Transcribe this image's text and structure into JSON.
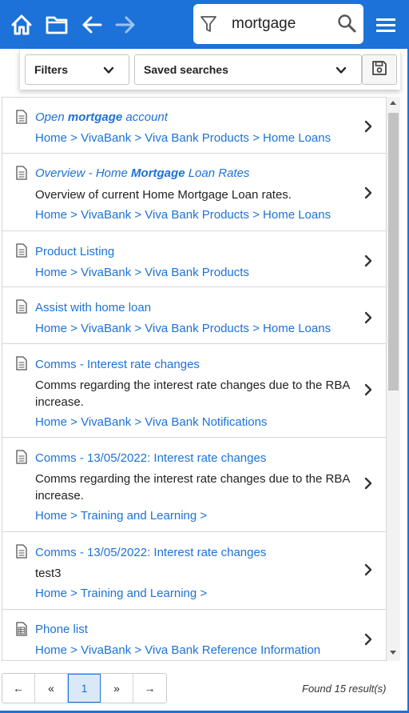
{
  "colors": {
    "accent": "#1c72d8",
    "arrow_disabled": "#9cc2f0"
  },
  "toolbar": {
    "home_icon": "home-icon",
    "folder_icon": "folder-icon",
    "back_icon": "arrow-left-icon",
    "forward_icon": "arrow-right-icon",
    "menu_icon": "hamburger-menu-icon"
  },
  "search": {
    "value": "mortgage",
    "placeholder": ""
  },
  "filters": {
    "filters_label": "Filters",
    "saved_searches_label": "Saved searches"
  },
  "results": [
    {
      "title_parts": [
        "Open ",
        "mortgage",
        " account"
      ],
      "italic": true,
      "description": "",
      "path": "Home > VivaBank > Viva Bank Products > Home Loans",
      "icon": "document-icon"
    },
    {
      "title_parts": [
        "Overview - Home ",
        "Mortgage",
        " Loan Rates"
      ],
      "italic": true,
      "description": "Overview of current Home Mortgage Loan rates.",
      "path": "Home > VivaBank > Viva Bank Products > Home Loans",
      "icon": "document-icon"
    },
    {
      "title": "Product Listing",
      "description": "",
      "path": "Home > VivaBank > Viva Bank Products",
      "icon": "document-icon"
    },
    {
      "title": "Assist with home loan",
      "description": "",
      "path": "Home > VivaBank > Viva Bank Products > Home Loans",
      "icon": "document-icon"
    },
    {
      "title": "Comms - Interest rate changes",
      "description": "Comms regarding the interest rate changes due to the RBA increase.",
      "path": "Home > VivaBank > Viva Bank Notifications",
      "icon": "document-icon"
    },
    {
      "title": "Comms - 13/05/2022: Interest rate changes",
      "description": "Comms regarding the interest rate changes due to the RBA increase.",
      "path": "Home > Training and Learning >",
      "icon": "document-icon"
    },
    {
      "title": "Comms - 13/05/2022: Interest rate changes",
      "description": "test3",
      "path": "Home > Training and Learning >",
      "icon": "document-icon"
    },
    {
      "title": "Phone list",
      "description": "",
      "path": "Home > VivaBank > Viva Bank Reference Information",
      "icon": "spreadsheet-icon"
    }
  ],
  "pagination": {
    "first": "←",
    "prev": "«",
    "current": "1",
    "next": "»",
    "last": "→"
  },
  "found_text": "Found 15 result(s)"
}
